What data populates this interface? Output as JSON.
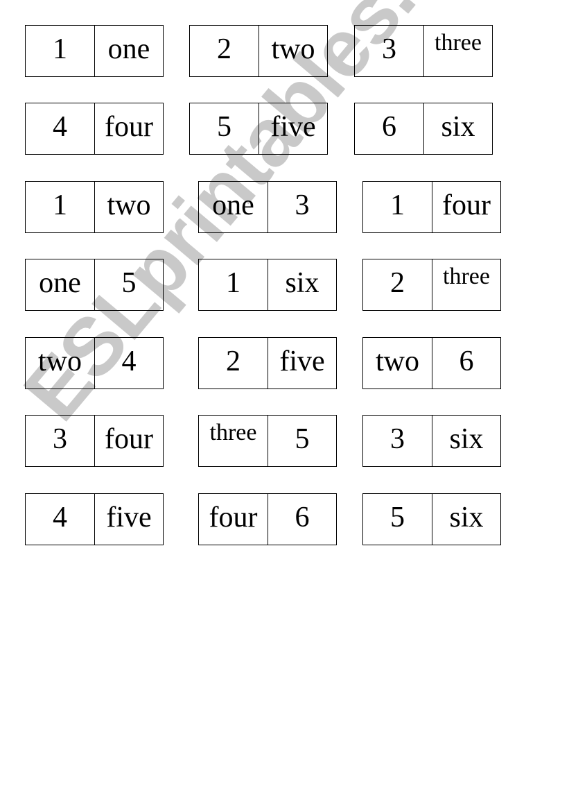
{
  "watermark": "ESLprintables.com",
  "rows": [
    [
      [
        "1",
        "one"
      ],
      [
        "2",
        "two"
      ],
      [
        "3",
        "three"
      ]
    ],
    [
      [
        "4",
        "four"
      ],
      [
        "5",
        "five"
      ],
      [
        "6",
        "six"
      ]
    ],
    [
      [
        "1",
        "two"
      ],
      [
        "one",
        "3"
      ],
      [
        "1",
        "four"
      ]
    ],
    [
      [
        "one",
        "5"
      ],
      [
        "1",
        "six"
      ],
      [
        "2",
        "three"
      ]
    ],
    [
      [
        "two",
        "4"
      ],
      [
        "2",
        "five"
      ],
      [
        "two",
        "6"
      ]
    ],
    [
      [
        "3",
        "four"
      ],
      [
        "three",
        "5"
      ],
      [
        "3",
        "six"
      ]
    ],
    [
      [
        "4",
        "five"
      ],
      [
        "four",
        "6"
      ],
      [
        "5",
        "six"
      ]
    ]
  ]
}
